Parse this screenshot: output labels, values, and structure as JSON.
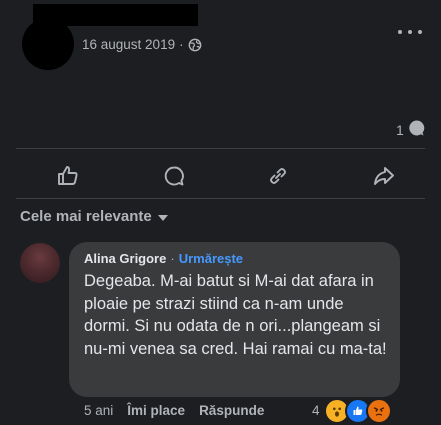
{
  "post": {
    "date": "16 august 2019",
    "dot": "·",
    "comment_count": "1",
    "icons": [
      "globe-icon",
      "more-icon",
      "comment-icon",
      "like-icon",
      "share-icon",
      "send-icon"
    ]
  },
  "sort": {
    "label": "Cele mai relevante"
  },
  "comment": {
    "author": "Alina Grigore",
    "separator": "·",
    "follow": "Urmărește",
    "text": "Degeaba. M-ai batut si M-ai dat afara in ploaie pe strazi stiind ca n-am unde dormi. Si nu odata de n ori...plangeam si nu-mi venea sa cred. Hai ramai cu ma-ta!",
    "time": "5 ani",
    "like": "Îmi place",
    "reply": "Răspunde",
    "reaction_count": "4",
    "reactions": [
      "wow",
      "like",
      "angry"
    ]
  },
  "colors": {
    "background": "#1c1e21",
    "bubble": "#3a3b3c",
    "text": "#e4e6eb",
    "secondary": "#b0b3b8",
    "link": "#4599ff"
  }
}
